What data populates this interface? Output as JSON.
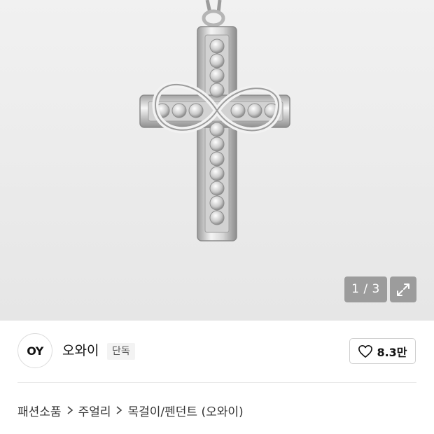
{
  "gallery": {
    "counter": "1 / 3",
    "expand_icon": "expand-icon",
    "background": "#ececec"
  },
  "seller": {
    "logo_text": "OY",
    "name": "오와이",
    "badge": "단독",
    "like_icon": "heart-outline-icon",
    "like_count": "8.3만"
  },
  "breadcrumb": {
    "items": [
      "패션소품",
      "주얼리",
      "목걸이/펜던트 (오와이)"
    ],
    "separator_icon": "chevron-right-icon"
  }
}
